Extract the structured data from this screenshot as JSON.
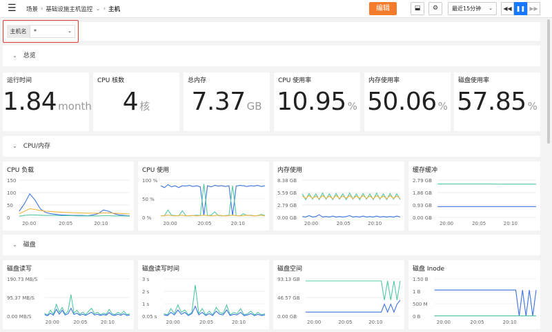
{
  "topbar": {
    "menu_icon": "hamburger-icon",
    "breadcrumb": [
      {
        "label": "场景"
      },
      {
        "label": "基础设施主机监控"
      },
      {
        "label": "主机"
      }
    ],
    "edit_label": "编辑",
    "time_range": "最近15分钟"
  },
  "variable": {
    "label": "主机名",
    "value": "*"
  },
  "sections": {
    "overview": "总览",
    "cpu_mem": "CPU/内存",
    "disk": "磁盘"
  },
  "stats": [
    {
      "title": "运行时间",
      "value": "1.84",
      "unit": "month"
    },
    {
      "title": "CPU 核数",
      "value": "4",
      "unit": "核"
    },
    {
      "title": "总内存",
      "value": "7.37",
      "unit": "GB"
    },
    {
      "title": "CPU 使用率",
      "value": "10.95",
      "unit": "%"
    },
    {
      "title": "内存使用率",
      "value": "50.06",
      "unit": "%"
    },
    {
      "title": "磁盘使用率",
      "value": "57.85",
      "unit": "%"
    }
  ],
  "chart_data": [
    {
      "type": "line",
      "title": "CPU 负载",
      "y_ticks": [
        "150",
        "100",
        "50",
        "0"
      ],
      "x_ticks": [
        "20:00",
        "20:05",
        "20:10"
      ],
      "ylim": [
        0,
        150
      ],
      "series": [
        {
          "color": "#3b73e3",
          "values": [
            25,
            55,
            95,
            70,
            35,
            20,
            15,
            12,
            10,
            9,
            8,
            8,
            8,
            7,
            10,
            15,
            30,
            25,
            15,
            10,
            8,
            6
          ]
        },
        {
          "color": "#f2b33d",
          "values": [
            15,
            25,
            35,
            32,
            28,
            25,
            24,
            22,
            21,
            20,
            19,
            18,
            18,
            17,
            17,
            17,
            18,
            18,
            17,
            16,
            15,
            14
          ]
        },
        {
          "color": "#52c8a6",
          "values": [
            5,
            8,
            10,
            10,
            9,
            8,
            8,
            8,
            7,
            7,
            7,
            6,
            6,
            6,
            6,
            6,
            7,
            7,
            6,
            6,
            6,
            5
          ]
        }
      ]
    },
    {
      "type": "line",
      "title": "CPU 使用",
      "y_ticks": [
        "100 %",
        "50 %",
        "0 %"
      ],
      "x_ticks": [
        "20:00",
        "20:05",
        "20:10"
      ],
      "ylim": [
        0,
        100
      ],
      "series": [
        {
          "color": "#3b73e3",
          "values": [
            85,
            80,
            88,
            82,
            85,
            80,
            85,
            84,
            86,
            83,
            85,
            82,
            5,
            85,
            82,
            86,
            84,
            85,
            83,
            85,
            5,
            84,
            86,
            85,
            83,
            85,
            84,
            86,
            83,
            85
          ]
        },
        {
          "color": "#52c8a6",
          "values": [
            5,
            4,
            20,
            6,
            5,
            4,
            18,
            5,
            4,
            5,
            6,
            5,
            90,
            5,
            6,
            15,
            5,
            4,
            5,
            6,
            85,
            5,
            4,
            10,
            5,
            6,
            4,
            5,
            8,
            5
          ]
        },
        {
          "color": "#f2b33d",
          "values": [
            4,
            5,
            6,
            5,
            4,
            5,
            6,
            4,
            5,
            5,
            4,
            5,
            6,
            5,
            4,
            5,
            6,
            5,
            4,
            5,
            6,
            5,
            4,
            5,
            6,
            5,
            4,
            5,
            6,
            4
          ]
        }
      ]
    },
    {
      "type": "line",
      "title": "内存使用",
      "y_ticks": [
        "8.38 GB",
        "5.59 GB",
        "2.79 GB",
        "0.00 GB"
      ],
      "x_ticks": [
        "20:00",
        "20:05",
        "20:10"
      ],
      "ylim": [
        0,
        8.38
      ],
      "series": [
        {
          "color": "#52c8a6",
          "values": [
            5.3,
            4.0,
            5.4,
            4.1,
            5.3,
            4.0,
            5.5,
            4.1,
            5.3,
            4.0,
            5.4,
            4.1,
            5.3,
            4.0,
            5.5,
            4.1,
            5.3,
            4.0,
            5.4,
            4.1,
            5.3,
            4.0,
            5.5,
            4.1,
            5.3,
            4.0,
            5.4,
            4.1,
            5.3,
            4.0
          ]
        },
        {
          "color": "#f2b33d",
          "values": [
            4.8,
            4.3,
            4.9,
            4.3,
            4.8,
            4.2,
            4.9,
            4.3,
            4.8,
            4.2,
            4.9,
            4.3,
            4.8,
            4.3,
            4.9,
            4.2,
            4.8,
            4.3,
            4.9,
            4.3,
            4.8,
            4.2,
            4.9,
            4.3,
            4.8,
            4.2,
            4.9,
            4.3,
            4.8,
            4.3
          ]
        },
        {
          "color": "#3b73e3",
          "values": [
            0.2,
            0.1,
            0.4,
            0.1,
            0.2,
            0.6,
            0.1,
            0.2,
            0.1,
            0.3,
            0.1,
            0.2,
            0.1,
            0.2,
            0.4,
            0.1,
            0.2,
            0.1,
            0.3,
            0.1,
            0.2,
            0.1,
            0.3,
            0.1,
            0.2,
            0.1,
            0.2,
            0.1,
            0.3,
            0.1
          ]
        }
      ]
    },
    {
      "type": "line",
      "title": "缓存缓冲",
      "y_ticks": [
        "2.79 GB",
        "1.86 GB",
        "0.93 GB",
        "0.00 GB"
      ],
      "x_ticks": [
        "20:00",
        "20:05",
        "20:10"
      ],
      "ylim": [
        0,
        2.79
      ],
      "series": [
        {
          "color": "#52c8a6",
          "values": [
            2.5,
            2.5,
            2.5,
            2.5,
            2.5,
            2.5,
            2.5,
            2.49,
            2.49,
            2.49,
            2.49,
            2.49
          ]
        },
        {
          "color": "#3b73e3",
          "values": [
            0.81,
            0.81,
            0.81,
            0.81,
            0.81,
            0.81,
            0.81,
            0.81,
            0.81,
            0.81,
            0.81,
            0.81
          ]
        }
      ]
    },
    {
      "type": "line",
      "title": "磁盘读写",
      "y_ticks": [
        "190.73 MB/S",
        "95.37 MB/S",
        "0.00 MB/S"
      ],
      "x_ticks": [
        "20:00",
        "20:05",
        "20:10"
      ],
      "ylim": [
        0,
        190.73
      ],
      "series": [
        {
          "color": "#52c8a6",
          "values": [
            15,
            5,
            30,
            10,
            60,
            20,
            45,
            10,
            25,
            110,
            15,
            30,
            10,
            20,
            8,
            25,
            40,
            12,
            20,
            8,
            15,
            10,
            35,
            12,
            8,
            20,
            10,
            25,
            8,
            12
          ]
        },
        {
          "color": "#3b73e3",
          "values": [
            8,
            3,
            15,
            5,
            35,
            10,
            30,
            6,
            12,
            40,
            8,
            15,
            5,
            10,
            4,
            12,
            20,
            6,
            10,
            4,
            8,
            5,
            18,
            6,
            4,
            10,
            5,
            12,
            4,
            6
          ]
        }
      ]
    },
    {
      "type": "line",
      "title": "磁盘读写时间",
      "y_ticks": [
        "3 s",
        "2 s",
        "1 s",
        "0.05 s"
      ],
      "x_ticks": [
        "20:00",
        "20:05",
        "20:10"
      ],
      "ylim": [
        0,
        3
      ],
      "series": [
        {
          "color": "#52c8a6",
          "values": [
            0.2,
            0.1,
            0.6,
            0.2,
            0.9,
            0.3,
            0.5,
            0.1,
            0.3,
            2.5,
            0.2,
            0.6,
            0.1,
            0.4,
            0.1,
            0.7,
            0.3,
            0.2,
            0.9,
            0.1,
            0.3,
            0.2,
            0.6,
            0.1,
            0.2,
            0.4,
            0.1,
            0.3,
            0.1,
            0.2
          ]
        },
        {
          "color": "#3b73e3",
          "values": [
            0.1,
            0.05,
            0.3,
            0.1,
            0.5,
            0.15,
            0.3,
            0.05,
            0.2,
            0.8,
            0.1,
            0.3,
            0.05,
            0.2,
            0.05,
            0.4,
            0.15,
            0.1,
            0.5,
            0.05,
            0.15,
            0.1,
            0.3,
            0.05,
            0.1,
            0.2,
            0.05,
            0.15,
            0.05,
            0.1
          ]
        }
      ]
    },
    {
      "type": "line",
      "title": "磁盘空间",
      "y_ticks": [
        "93.13 GB",
        "46.57 GB",
        "0.00 GB"
      ],
      "x_ticks": [
        "20:00",
        "20:05",
        "20:10"
      ],
      "ylim": [
        0,
        93.13
      ],
      "series": [
        {
          "color": "#52c8a6",
          "values": [
            88,
            88,
            88,
            88,
            88,
            88,
            88,
            88,
            88,
            88,
            88,
            88,
            88,
            88,
            88,
            88,
            88,
            88,
            88,
            88,
            88,
            88,
            88,
            88,
            88,
            40,
            88,
            40,
            88,
            40,
            88
          ]
        },
        {
          "color": "#3b73e3",
          "values": [
            10,
            10,
            10,
            10,
            10,
            10,
            10,
            10,
            10,
            10,
            10,
            10,
            10,
            10,
            10,
            10,
            10,
            10,
            10,
            10,
            10,
            10,
            10,
            10,
            10,
            30,
            10,
            30,
            10,
            30,
            40
          ]
        }
      ]
    },
    {
      "type": "line",
      "title": "磁盘 Inode",
      "y_ticks": [
        "1.50 B",
        "1 B",
        "500 M",
        "0 B"
      ],
      "x_ticks": [
        "20:00",
        "20:05",
        "20:10"
      ],
      "ylim": [
        0,
        1.5
      ],
      "series": [
        {
          "color": "#3b73e3",
          "values": [
            1.05,
            1.05,
            1.05,
            1.05,
            1.05,
            1.05,
            1.05,
            1.05,
            1.05,
            1.05,
            1.05,
            1.05,
            1.05,
            1.05,
            1.05,
            1.05,
            1.05,
            1.05,
            1.05,
            1.05,
            1.05,
            1.05,
            1.05,
            1.05,
            1.05,
            0,
            1.05,
            0,
            1.05,
            0,
            1.05
          ]
        },
        {
          "color": "#52c8a6",
          "values": [
            0.01,
            0.01,
            0.01,
            0.01,
            0.01,
            0.01,
            0.01,
            0.01,
            0.01,
            0.01,
            0.01,
            0.01,
            0.01,
            0.01,
            0.01,
            0.01,
            0.01,
            0.01,
            0.01,
            0.01,
            0.01,
            0.01,
            0.01,
            0.01,
            0.01,
            0.01,
            0.01,
            0.01,
            0.01,
            0.01,
            0.01
          ]
        }
      ]
    }
  ]
}
